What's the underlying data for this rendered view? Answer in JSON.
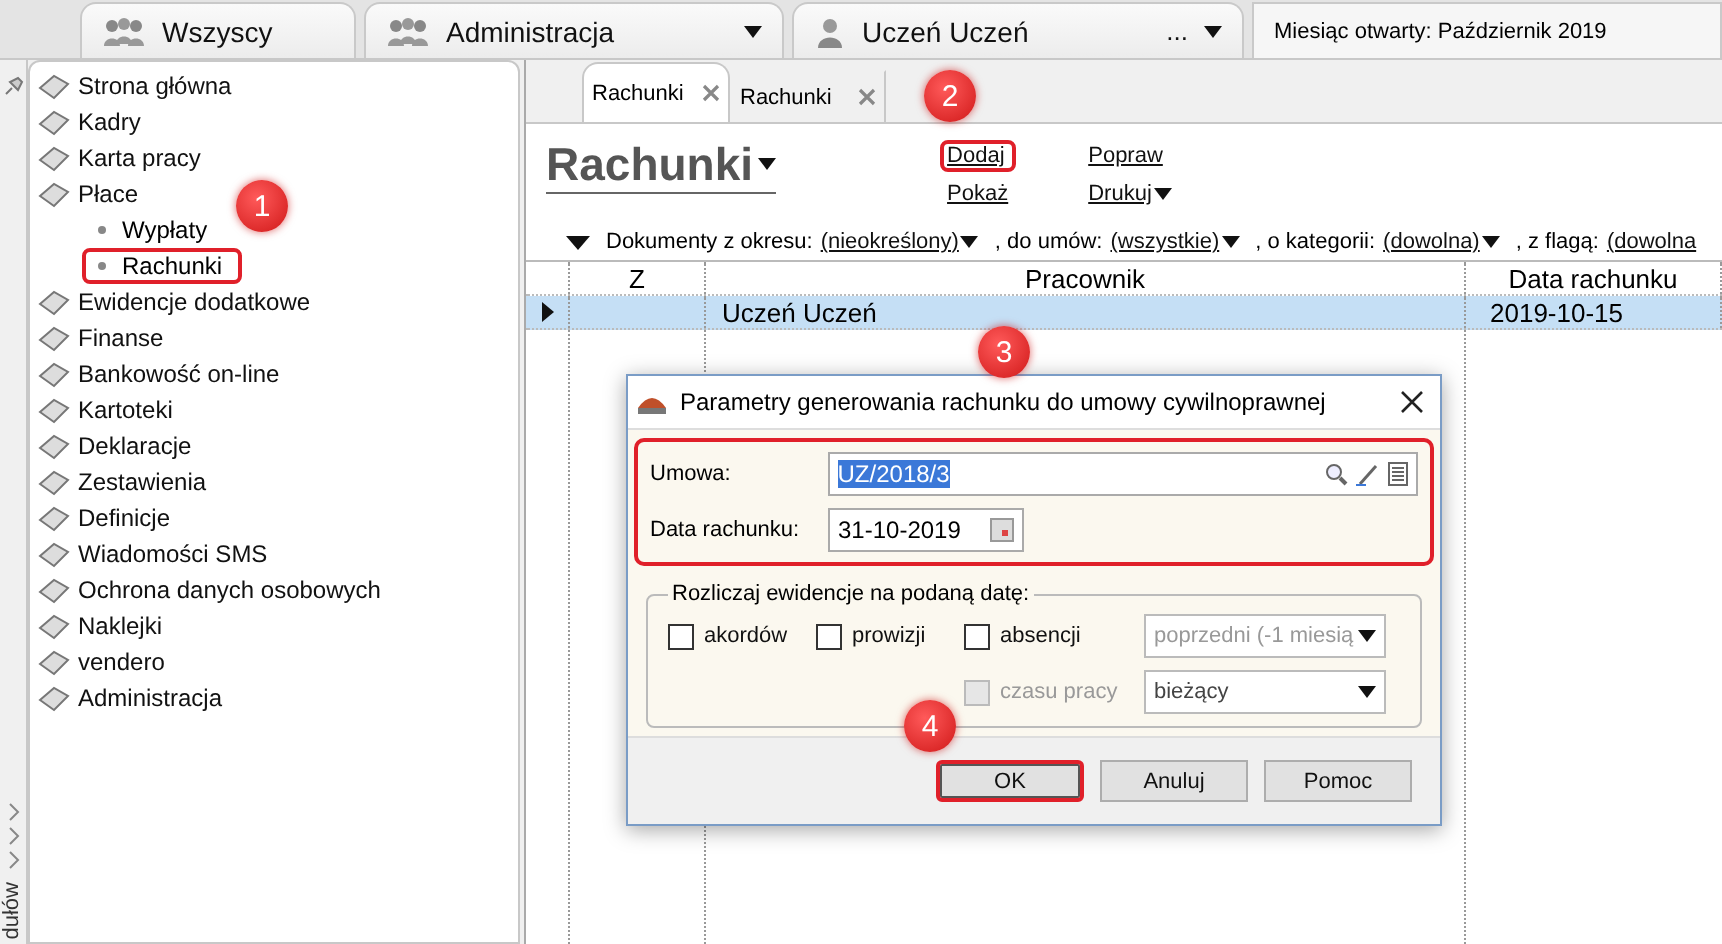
{
  "top_bar": {
    "tabs": [
      {
        "label": "Wszyscy",
        "kind": "group",
        "dropdown": false
      },
      {
        "label": "Administracja",
        "kind": "group",
        "dropdown": true
      },
      {
        "label": "Uczeń Uczeń",
        "kind": "person",
        "more": "...",
        "dropdown": true
      }
    ],
    "period": "Miesiąc otwarty: Październik 2019"
  },
  "sidebar": {
    "items": [
      {
        "label": "Strona główna"
      },
      {
        "label": "Kadry"
      },
      {
        "label": "Karta pracy"
      },
      {
        "label": "Płace",
        "children": [
          {
            "label": "Wypłaty",
            "highlighted": false
          },
          {
            "label": "Rachunki",
            "highlighted": true
          }
        ]
      },
      {
        "label": "Ewidencje dodatkowe"
      },
      {
        "label": "Finanse"
      },
      {
        "label": "Bankowość on-line"
      },
      {
        "label": "Kartoteki"
      },
      {
        "label": "Deklaracje"
      },
      {
        "label": "Zestawienia"
      },
      {
        "label": "Definicje"
      },
      {
        "label": "Wiadomości SMS"
      },
      {
        "label": "Ochrona danych osobowych"
      },
      {
        "label": "Naklejki"
      },
      {
        "label": "vendero"
      },
      {
        "label": "Administracja"
      }
    ],
    "strip_label": "dułów"
  },
  "tabs": [
    {
      "label": "Rachunki",
      "selected": true
    },
    {
      "label": "Rachunki",
      "selected": false
    }
  ],
  "title": "Rachunki",
  "actions": [
    [
      {
        "label": "Dodaj",
        "dropdown": false,
        "highlighted": true
      },
      {
        "label": "Pokaż",
        "dropdown": false,
        "highlighted": false
      }
    ],
    [
      {
        "label": "Popraw",
        "dropdown": false,
        "highlighted": false
      },
      {
        "label": "Drukuj",
        "dropdown": true,
        "highlighted": false
      }
    ]
  ],
  "filters": [
    {
      "label": "Dokumenty z okresu:",
      "value": "(nieokreślony)",
      "dropdown": true
    },
    {
      "label": ", do umów:",
      "value": "(wszystkie)",
      "dropdown": true
    },
    {
      "label": ", o kategorii:",
      "value": "(dowolna)",
      "dropdown": true
    },
    {
      "label": ", z flagą:",
      "value": "(dowolna",
      "dropdown": false
    }
  ],
  "table": {
    "columns": [
      "Z",
      "Pracownik",
      "Data rachunku"
    ],
    "rows": [
      {
        "employee": "Uczeń Uczeń",
        "date": "2019-10-15",
        "selected": true
      }
    ]
  },
  "dialog": {
    "title": "Parametry generowania rachunku do umowy cywilnoprawnej",
    "fields_highlighted": true,
    "fields": [
      {
        "label": "Umowa:",
        "value": "UZ/2018/3",
        "kind": "lookup",
        "text_selected": true
      },
      {
        "label": "Data rachunku:",
        "value": "31-10-2019",
        "kind": "date",
        "text_selected": false
      }
    ],
    "group": {
      "title": "Rozliczaj ewidencje na podaną datę:",
      "checks": [
        {
          "label": "akordów",
          "checked": false,
          "disabled": false
        },
        {
          "label": "prowizji",
          "checked": false,
          "disabled": false
        },
        {
          "label": "absencji",
          "checked": false,
          "disabled": false
        },
        {
          "label": "czasu pracy",
          "checked": false,
          "disabled": true
        }
      ],
      "selects": [
        {
          "value": "poprzedni (-1 miesią",
          "disabled": true
        },
        {
          "value": "bieżący",
          "disabled": false
        }
      ]
    },
    "buttons": [
      {
        "label": "OK",
        "highlighted": true
      },
      {
        "label": "Anuluj",
        "highlighted": false
      },
      {
        "label": "Pomoc",
        "highlighted": false
      }
    ]
  },
  "annotations": [
    {
      "number": "1"
    },
    {
      "number": "2"
    },
    {
      "number": "3"
    },
    {
      "number": "4"
    }
  ]
}
